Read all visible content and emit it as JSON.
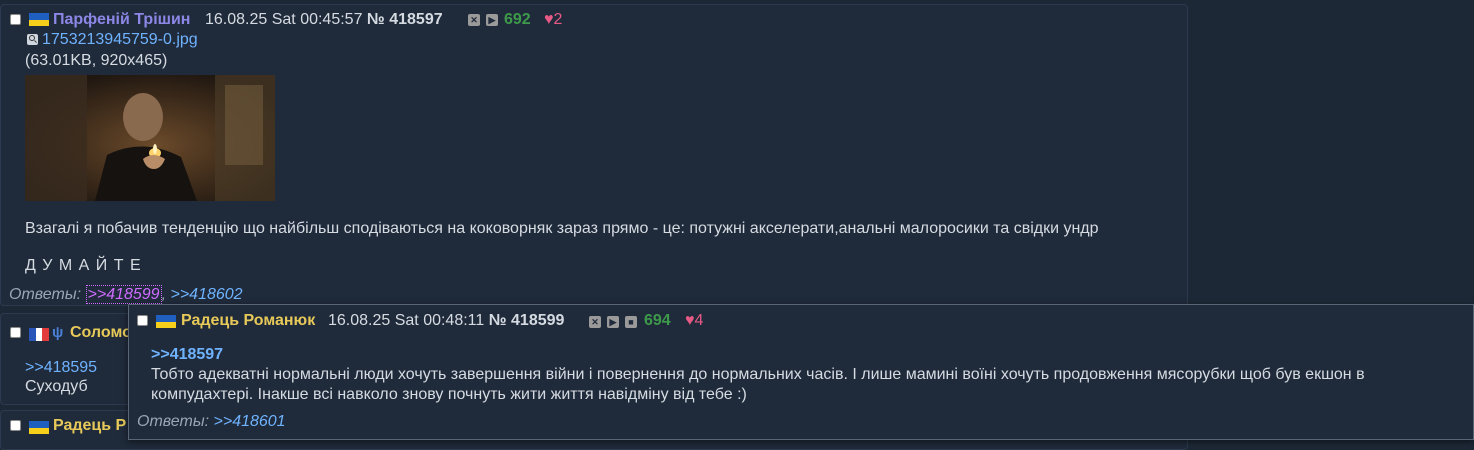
{
  "posts": [
    {
      "name": "Парфеній Трішин",
      "datetime": "16.08.25 Sat 00:45:57",
      "num_prefix": "№",
      "num": "418597",
      "count": "692",
      "likes": "♥2",
      "file_name": "1753213945759-0.jpg",
      "file_info": "(63.01KB, 920x465)",
      "text": "Взагалі я побачив тенденцію що найбільш сподіваються на коковорняк зараз прямо - це: потужні акселерати,анальні малоросики та свідки ундр",
      "shout": "Д У М А Й Т Е",
      "answers_label": "Ответы:",
      "answers": [
        ">>418599",
        ">>418602"
      ]
    },
    {
      "name_visible": "Соломо",
      "reply_link": ">>418595",
      "text": "Суходуб"
    },
    {
      "name_visible": "Радець Р"
    }
  ],
  "preview": {
    "name": "Радець Романюк",
    "datetime": "16.08.25 Sat 00:48:11",
    "num_prefix": "№",
    "num": "418599",
    "count": "694",
    "likes": "♥4",
    "reply_link": ">>418597",
    "text_line1": "Тобто адекватні нормальні люди хочуть завершення війни і повернення до нормальних часів. І лише мамині воїні хочуть продовження мясорубки щоб був екшон в",
    "text_line2": "компудахтері. Інакше всі навколо знову почнуть жити життя навідміну від тебе :)",
    "answers_label": "Ответы:",
    "answers": [
      ">>418601"
    ]
  },
  "colors": {
    "background": "#1d2837",
    "name_primary": "#8c87e6",
    "name_secondary": "#e7c95a",
    "count": "#3d9a4a",
    "likes": "#e85a86",
    "link": "#6fb3ff",
    "link_hovered": "#cf6bff"
  },
  "icons": [
    "ukraine-flag-icon",
    "france-flag-icon",
    "tryzub-icon",
    "magnifier-icon",
    "hide-icon",
    "play-icon",
    "stop-icon"
  ]
}
